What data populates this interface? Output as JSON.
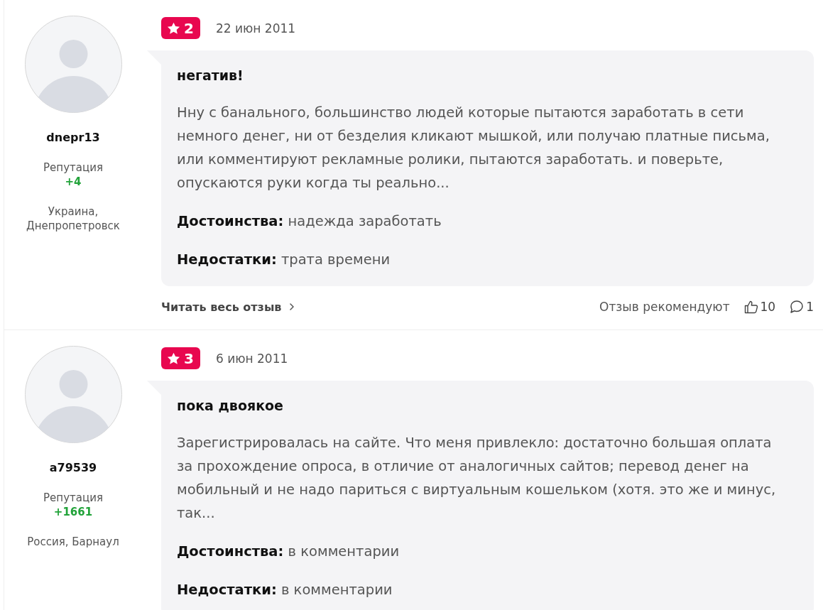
{
  "reviews": [
    {
      "author": {
        "name": "dnepr13",
        "reputation_label": "Репутация",
        "reputation": "+4",
        "location": "Украина, Днепропетровск"
      },
      "rating": "2",
      "date": "22 июн 2011",
      "title": "негатив!",
      "text": "Нну с банального, большинство людей которые пытаются заработать в сети немного денег, ни от безделия кликают мышкой, или получаю платные письма, или комментируют рекламные ролики, пытаются заработать. и поверьте, опускаются руки когда ты реально...",
      "pros": "**Достоинства:** надежда заработать",
      "cons": "**Недостатки:** трата времени",
      "footer": {
        "read_more": "Читать весь отзыв",
        "recommend_label": "Отзыв рекомендуют",
        "likes": "10",
        "comments": "1"
      }
    },
    {
      "author": {
        "name": "a79539",
        "reputation_label": "Репутация",
        "reputation": "+1661",
        "location": "Россия, Барнаул"
      },
      "rating": "3",
      "date": "6 июн 2011",
      "title": "пока двоякое",
      "text": "Зарегистрировалась на сайте. Что меня привлекло: достаточно большая оплата за прохождение опроса, в отличие от аналогичных сайтов; перевод денег на мобильный и не надо париться с виртуальным кошельком (хотя. это же и минус, так...",
      "pros": "**Достоинства:** в комментарии",
      "cons": "**Недостатки:** в комментарии"
    }
  ]
}
